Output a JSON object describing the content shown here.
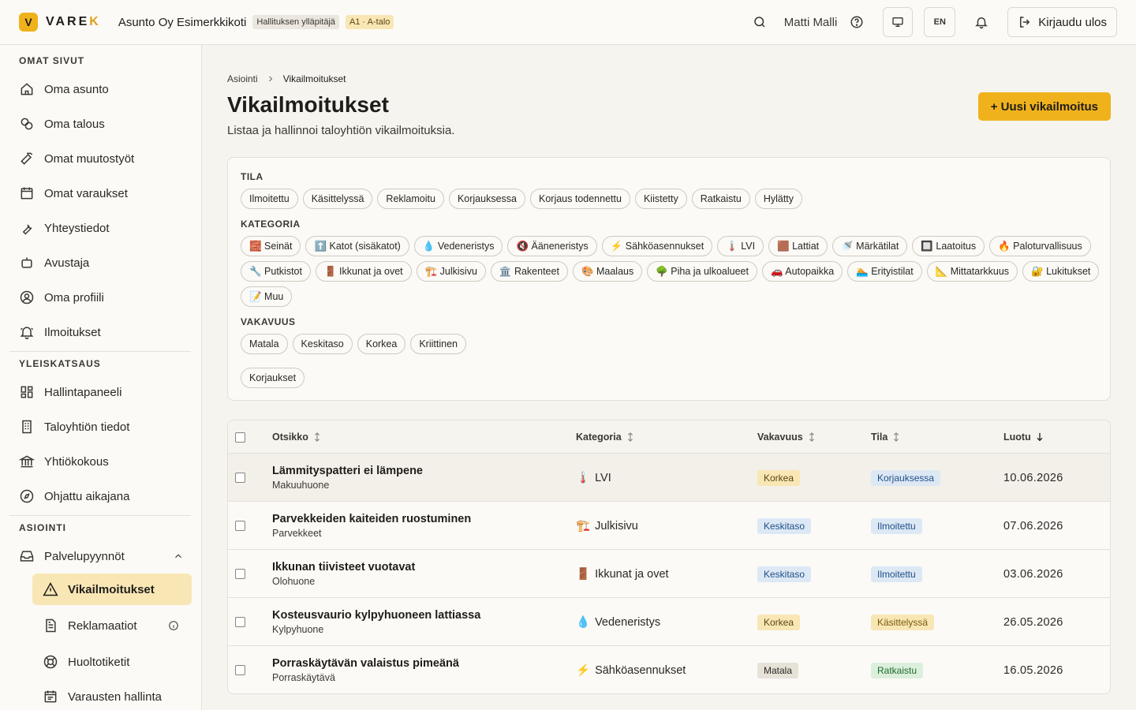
{
  "header": {
    "logo_mark": "V",
    "logo_text_a": "VARE",
    "logo_text_b": "K",
    "org": "Asunto Oy Esimerkkikoti",
    "role_tag": "Hallituksen ylläpitäjä",
    "unit_tag": "A1 · A-talo",
    "user": "Matti Malli",
    "lang": "EN",
    "logout": "Kirjaudu ulos"
  },
  "sidebar": {
    "sec1": "OMAT SIVUT",
    "omat": [
      "Oma asunto",
      "Oma talous",
      "Omat muutostyöt",
      "Omat varaukset",
      "Yhteystiedot",
      "Avustaja",
      "Oma profiili",
      "Ilmoitukset"
    ],
    "sec2": "YLEISKATSAUS",
    "yleis": [
      "Hallintapaneeli",
      "Taloyhtiön tiedot",
      "Yhtiökokous",
      "Ohjattu aikajana"
    ],
    "sec3": "ASIOINTI",
    "palvelu": "Palvelupyynnöt",
    "sub": [
      "Vikailmoitukset",
      "Reklamaatiot",
      "Huoltotiketit",
      "Varausten hallinta"
    ]
  },
  "main": {
    "crumb_root": "Asiointi",
    "crumb_current": "Vikailmoitukset",
    "title": "Vikailmoitukset",
    "subtitle": "Listaa ja hallinnoi taloyhtiön vikailmoituksia.",
    "new_button": "+ Uusi vikailmoitus"
  },
  "filters": {
    "tila_label": "TILA",
    "tila": [
      "Ilmoitettu",
      "Käsittelyssä",
      "Reklamoitu",
      "Korjauksessa",
      "Korjaus todennettu",
      "Kiistetty",
      "Ratkaistu",
      "Hylätty"
    ],
    "kategoria_label": "KATEGORIA",
    "kategoria": [
      "🧱 Seinät",
      "⬆️ Katot (sisäkatot)",
      "💧 Vedeneristys",
      "🔇 Ääneneristys",
      "⚡ Sähköasennukset",
      "🌡️ LVI",
      "🟫 Lattiat",
      "🚿 Märkätilat",
      "🔲 Laatoitus",
      "🔥 Paloturvallisuus",
      "🔧 Putkistot",
      "🚪 Ikkunat ja ovet",
      "🏗️ Julkisivu",
      "🏛️ Rakenteet",
      "🎨 Maalaus",
      "🌳 Piha ja ulkoalueet",
      "🚗 Autopaikka",
      "🏊 Erityistilat",
      "📐 Mittatarkkuus",
      "🔐 Lukitukset",
      "📝 Muu"
    ],
    "vakavuus_label": "VAKAVUUS",
    "vakavuus": [
      "Matala",
      "Keskitaso",
      "Korkea",
      "Kriittinen"
    ],
    "extra": "Korjaukset"
  },
  "table": {
    "headers": {
      "title": "Otsikko",
      "category": "Kategoria",
      "severity": "Vakavuus",
      "status": "Tila",
      "created": "Luotu"
    },
    "rows": [
      {
        "title": "Lämmityspatteri ei lämpene",
        "location": "Makuuhuone",
        "cat_icon": "🌡️",
        "category": "LVI",
        "severity": "Korkea",
        "status": "Korjauksessa",
        "date": "10.06.2026"
      },
      {
        "title": "Parvekkeiden kaiteiden ruostuminen",
        "location": "Parvekkeet",
        "cat_icon": "🏗️",
        "category": "Julkisivu",
        "severity": "Keskitaso",
        "status": "Ilmoitettu",
        "date": "07.06.2026"
      },
      {
        "title": "Ikkunan tiivisteet vuotavat",
        "location": "Olohuone",
        "cat_icon": "🚪",
        "category": "Ikkunat ja ovet",
        "severity": "Keskitaso",
        "status": "Ilmoitettu",
        "date": "03.06.2026"
      },
      {
        "title": "Kosteusvaurio kylpyhuoneen lattiassa",
        "location": "Kylpyhuone",
        "cat_icon": "💧",
        "category": "Vedeneristys",
        "severity": "Korkea",
        "status": "Käsittelyssä",
        "date": "26.05.2026"
      },
      {
        "title": "Porraskäytävän valaistus pimeänä",
        "location": "Porraskäytävä",
        "cat_icon": "⚡",
        "category": "Sähköasennukset",
        "severity": "Matala",
        "status": "Ratkaistu",
        "date": "16.05.2026"
      }
    ]
  },
  "colors": {
    "accent": "#f0b21c",
    "active_bg": "#f8e7b5"
  }
}
